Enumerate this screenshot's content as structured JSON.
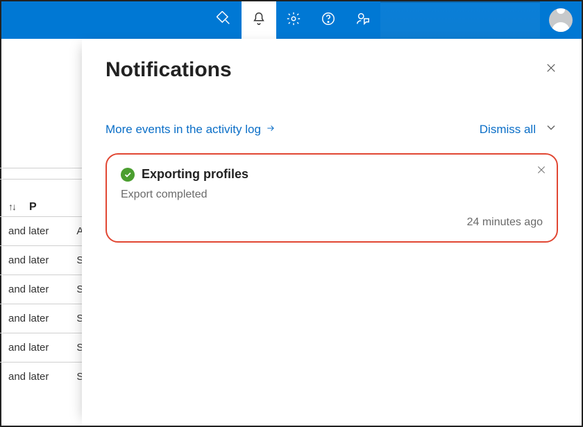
{
  "topbar": {
    "icons": {
      "diagnostics": "diagnostics-icon",
      "notifications": "bell-icon",
      "settings": "gear-icon",
      "help": "help-icon",
      "feedback": "feedback-icon"
    }
  },
  "panel": {
    "title": "Notifications",
    "more_events_label": "More events in the activity log",
    "dismiss_all_label": "Dismiss all"
  },
  "notifications": [
    {
      "status": "success",
      "title": "Exporting profiles",
      "description": "Export completed",
      "timestamp": "24 minutes ago"
    }
  ],
  "background_table": {
    "sort_col": "↑↓",
    "col_p": "P",
    "rows": [
      {
        "a": "and later",
        "b": "A"
      },
      {
        "a": "and later",
        "b": "S"
      },
      {
        "a": "and later",
        "b": "S"
      },
      {
        "a": "and later",
        "b": "S"
      },
      {
        "a": "and later",
        "b": "S"
      },
      {
        "a": "and later",
        "b": "S"
      }
    ]
  }
}
